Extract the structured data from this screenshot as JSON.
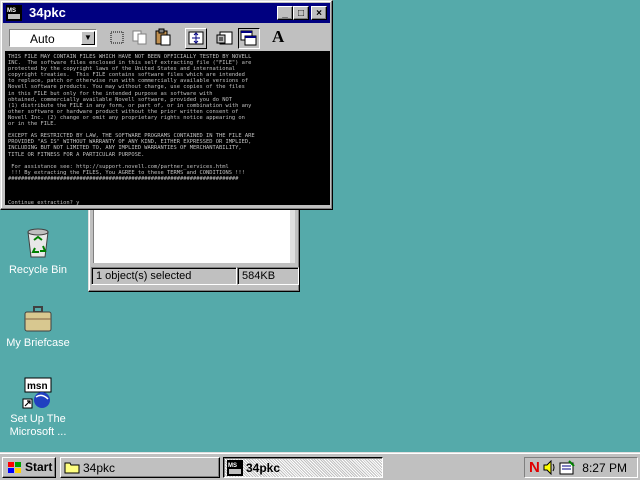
{
  "desktop": {
    "icons": [
      {
        "label": "Recycle Bin",
        "icon": "recycle-bin-icon"
      },
      {
        "label": "My Briefcase",
        "icon": "briefcase-icon"
      },
      {
        "label_line1": "Set Up The",
        "label_line2": "Microsoft ...",
        "icon": "msn-icon"
      }
    ],
    "background_color": "#55aaaa"
  },
  "explorer": {
    "status_selected": "1 object(s) selected",
    "status_size": "584KB"
  },
  "dos_window": {
    "title": "34pkc",
    "font_size_value": "Auto",
    "titlebar_buttons": {
      "minimize": "_",
      "maximize": "□",
      "close": "×"
    },
    "toolbar_icons": [
      "mark-icon",
      "copy-icon",
      "paste-icon",
      "fullscreen-icon",
      "properties-icon",
      "background-icon",
      "font-icon"
    ],
    "font_button_label": "A",
    "console_text": "THIS FILE MAY CONTAIN FILES WHICH HAVE NOT BEEN OFFICIALLY TESTED BY NOVELL\nINC.  The software files enclosed in this self extracting file (\"FILE\") are\nprotected by the copyright laws of the United States and international\ncopyright treaties.  This FILE contains software files which are intended\nto replace, patch or otherwise run with commercially available versions of\nNovell software products. You may without charge, use copies of the files\nin this FILE but only for the intended purpose as software with\nobtained, commercially available Novell software, provided you do NOT\n(1) distribute the FILE in any form, or part of, or in combination with any\nother software or hardware product without the prior written consent of\nNovell Inc. (2) change or omit any proprietary rights notice appearing on\nor in the FILE.\n\nEXCEPT AS RESTRICTED BY LAW, THE SOFTWARE PROGRAMS CONTAINED IN THE FILE ARE\nPROVIDED \"AS IS\" WITHOUT WARRANTY OF ANY KIND, EITHER EXPRESSED OR IMPLIED,\nINCLUDING BUT NOT LIMITED TO, ANY IMPLIED WARRANTIES OF MERCHANTABILITY,\nTITLE OR FITNESS FOR A PARTICULAR PURPOSE.\n\n For assistance see: http://support.novell.com/partner_services.html\n !!! By extracting the FILES, You AGREE to these TERMS and CONDITIONS !!!\n#######################################################################\n\n\n\nContinue extraction? y"
  },
  "taskbar": {
    "start_label": "Start",
    "tasks": [
      {
        "label": "34pkc",
        "icon": "folder-icon",
        "state": "normal"
      },
      {
        "label": "34pkc",
        "icon": "msdos-icon",
        "state": "active"
      }
    ],
    "tray_icons": [
      "netware-icon",
      "volume-icon",
      "schedule-icon"
    ],
    "clock": "8:27 PM"
  }
}
